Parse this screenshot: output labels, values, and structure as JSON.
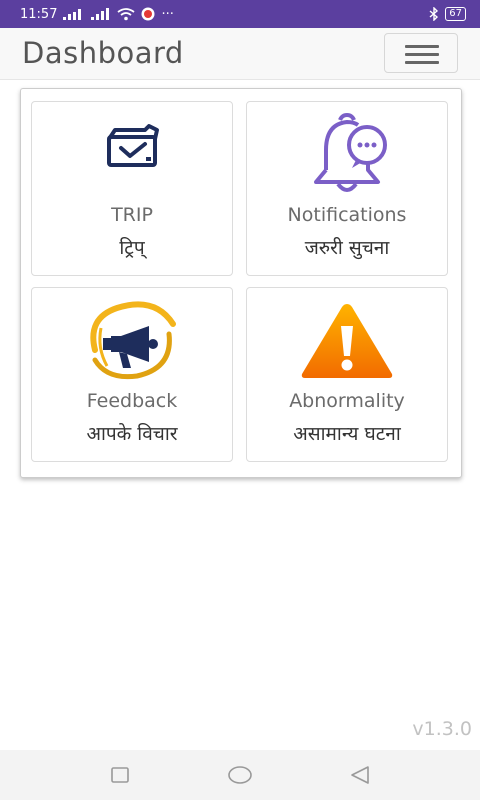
{
  "status_bar": {
    "time": "11:57",
    "battery": "67",
    "icons": [
      "signal-icon",
      "signal-icon",
      "wifi-icon",
      "app-notification-icon",
      "more-icon",
      "bluetooth-icon",
      "battery-icon"
    ],
    "more": "···"
  },
  "header": {
    "title": "Dashboard"
  },
  "tiles": [
    {
      "en": "TRIP",
      "hi": "ट्रिप्",
      "icon": "trip-icon"
    },
    {
      "en": "Notifications",
      "hi": "जरुरी सुचना",
      "icon": "bell-icon"
    },
    {
      "en": "Feedback",
      "hi": "आपके विचार",
      "icon": "megaphone-icon"
    },
    {
      "en": "Abnormality",
      "hi": "असामान्य घटना",
      "icon": "warning-icon"
    }
  ],
  "version": "v1.3.0",
  "colors": {
    "status_bar": "#5b3f9f",
    "bell": "#7b5fc7",
    "trip": "#1e2d5c",
    "warning": "#f57c00",
    "feedback_ring": "#f3b41b"
  }
}
